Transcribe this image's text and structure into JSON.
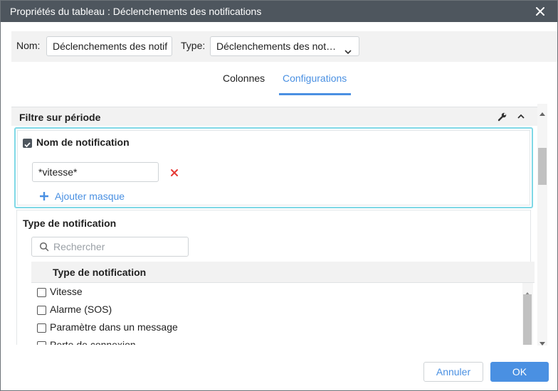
{
  "dialog": {
    "title": "Propriétés du tableau : Déclenchements des notifications"
  },
  "top": {
    "name_label": "Nom:",
    "name_value": "Déclenchements des notif",
    "type_label": "Type:",
    "type_value": "Déclenchements des notifications"
  },
  "tabs": [
    {
      "label": "Colonnes",
      "active": false
    },
    {
      "label": "Configurations",
      "active": true
    }
  ],
  "filter": {
    "section_title": "Filtre sur période",
    "notification_name": {
      "title": "Nom de notification",
      "checked": true,
      "mask_value": "*vitesse*",
      "add_mask_label": "Ajouter masque"
    },
    "notification_type": {
      "title": "Type de notification",
      "search_placeholder": "Rechercher",
      "column_header": "Type de notification",
      "items": [
        {
          "label": "Vitesse",
          "checked": false
        },
        {
          "label": "Alarme (SOS)",
          "checked": false
        },
        {
          "label": "Paramètre dans un message",
          "checked": false
        },
        {
          "label": "Perte de connexion",
          "checked": false
        }
      ]
    }
  },
  "footer": {
    "cancel_label": "Annuler",
    "ok_label": "OK"
  },
  "colors": {
    "accent": "#4a90e2",
    "titlebar": "#4e565e",
    "highlight_border": "#7fd8e6",
    "remove_red": "#e53935"
  }
}
